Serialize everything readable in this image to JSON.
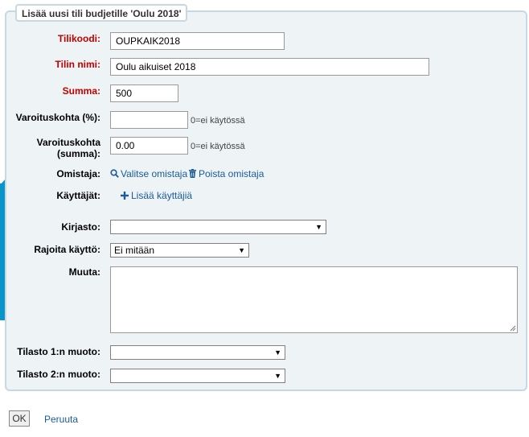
{
  "form": {
    "legend": "Lisää uusi tili budjetille 'Oulu 2018'",
    "fields": {
      "code": {
        "label": "Tilikoodi:",
        "value": "OUPKAIK2018"
      },
      "name": {
        "label": "Tilin nimi:",
        "value": "Oulu aikuiset 2018"
      },
      "amount": {
        "label": "Summa:",
        "value": "500"
      },
      "warn_percent": {
        "label": "Varoituskohta (%):",
        "value": "",
        "hint": "0=ei käytössä"
      },
      "warn_amount": {
        "label_line1": "Varoituskohta",
        "label_line2": "(summa):",
        "value": "0.00",
        "hint": "0=ei käytössä"
      },
      "owner": {
        "label": "Omistaja:",
        "choose_link": "Valitse omistaja",
        "remove_link": "Poista omistaja"
      },
      "users": {
        "label": "Käyttäjät:",
        "add_link": "Lisää käyttäjiä"
      },
      "library": {
        "label": "Kirjasto:",
        "selected": ""
      },
      "restrict": {
        "label": "Rajoita käyttö:",
        "selected": "Ei mitään"
      },
      "notes": {
        "label": "Muuta:",
        "value": ""
      },
      "stat1": {
        "label": "Tilasto 1:n muoto:",
        "selected": ""
      },
      "stat2": {
        "label": "Tilasto 2:n muoto:",
        "selected": ""
      }
    }
  },
  "actions": {
    "ok_label": "OK",
    "cancel_label": "Peruuta"
  },
  "colors": {
    "required_label": "#c00000",
    "link": "#1a5b9a",
    "fieldset_bg": "#eef3f6",
    "fieldset_border": "#c6d8e2",
    "accent_stripe": "#0b94c9"
  }
}
